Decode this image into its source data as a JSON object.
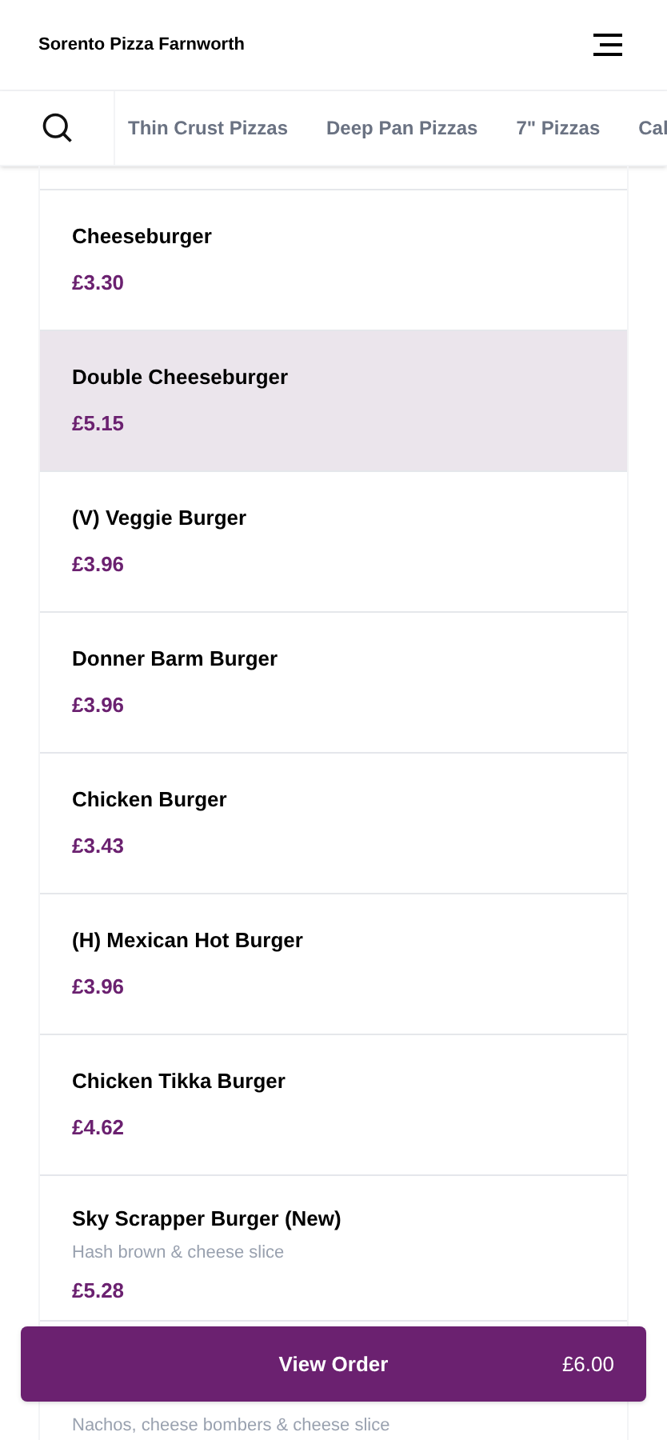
{
  "header": {
    "title": "Sorento Pizza Farnworth"
  },
  "categories": [
    {
      "label": "Thin Crust Pizzas",
      "selected": false
    },
    {
      "label": "Deep Pan Pizzas",
      "selected": false
    },
    {
      "label": "7\" Pizzas",
      "selected": false
    },
    {
      "label": "Cal",
      "selected": false
    }
  ],
  "items": [
    {
      "name": "Cheeseburger",
      "price": "£3.30",
      "selected": false
    },
    {
      "name": "Double Cheeseburger",
      "price": "£5.15",
      "selected": true
    },
    {
      "name": "(V) Veggie Burger",
      "price": "£3.96",
      "selected": false
    },
    {
      "name": "Donner Barm Burger",
      "price": "£3.96",
      "selected": false
    },
    {
      "name": "Chicken Burger",
      "price": "£3.43",
      "selected": false
    },
    {
      "name": "(H) Mexican Hot Burger",
      "price": "£3.96",
      "selected": false
    },
    {
      "name": "Chicken Tikka Burger",
      "price": "£4.62",
      "selected": false
    },
    {
      "name": "Sky Scrapper Burger (New)",
      "description": "Hash brown & cheese slice",
      "price": "£5.28",
      "selected": false
    },
    {
      "description": "Nachos, cheese bombers & cheese slice",
      "selected": false
    }
  ],
  "order_bar": {
    "label": "View Order",
    "total": "£6.00"
  }
}
